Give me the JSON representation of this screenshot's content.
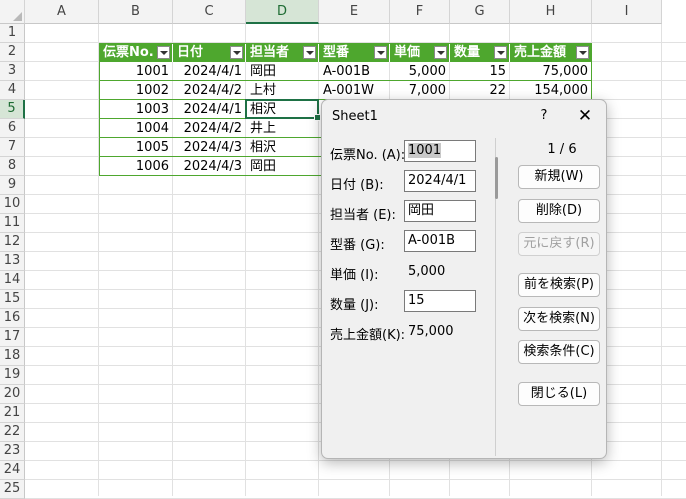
{
  "columns": [
    "A",
    "B",
    "C",
    "D",
    "E",
    "F",
    "G",
    "H",
    "I"
  ],
  "selected_column": "D",
  "rows": [
    "1",
    "2",
    "3",
    "4",
    "5",
    "6",
    "7",
    "8",
    "9",
    "10",
    "11",
    "12",
    "13",
    "14",
    "15",
    "16",
    "17",
    "18",
    "19",
    "20",
    "21",
    "22",
    "23",
    "24",
    "25"
  ],
  "selected_row": "5",
  "table": {
    "headers": [
      "伝票No.",
      "日付",
      "担当者",
      "型番",
      "単価",
      "数量",
      "売上金額"
    ],
    "records": [
      [
        "1001",
        "2024/4/1",
        "岡田",
        "A-001B",
        "5,000",
        "15",
        "75,000"
      ],
      [
        "1002",
        "2024/4/2",
        "上村",
        "A-001W",
        "7,000",
        "22",
        "154,000"
      ],
      [
        "1003",
        "2024/4/1",
        "相沢",
        "",
        "",
        "",
        ""
      ],
      [
        "1004",
        "2024/4/2",
        "井上",
        "",
        "",
        "",
        ""
      ],
      [
        "1005",
        "2024/4/3",
        "相沢",
        "",
        "",
        "",
        ""
      ],
      [
        "1006",
        "2024/4/3",
        "岡田",
        "",
        "",
        "",
        ""
      ]
    ],
    "accent_color": "#4ea72e"
  },
  "dialog": {
    "title": "Sheet1",
    "help": "?",
    "close": "✕",
    "counter": "1 / 6",
    "fields": [
      {
        "label": "伝票No. (A):",
        "value": "1001",
        "editable": true
      },
      {
        "label": "日付 (B):",
        "value": "2024/4/1",
        "editable": true
      },
      {
        "label": "担当者 (E):",
        "value": "岡田",
        "editable": true
      },
      {
        "label": "型番 (G):",
        "value": "A-001B",
        "editable": true
      },
      {
        "label": "単価 (I):",
        "value": "5,000",
        "editable": false
      },
      {
        "label": "数量 (J):",
        "value": "15",
        "editable": true
      },
      {
        "label": "売上金額(K):",
        "value": "75,000",
        "editable": false
      }
    ],
    "buttons": {
      "new": "新規(W)",
      "delete": "削除(D)",
      "restore": "元に戻す(R)",
      "find_prev": "前を検索(P)",
      "find_next": "次を検索(N)",
      "criteria": "検索条件(C)",
      "close": "閉じる(L)"
    }
  }
}
